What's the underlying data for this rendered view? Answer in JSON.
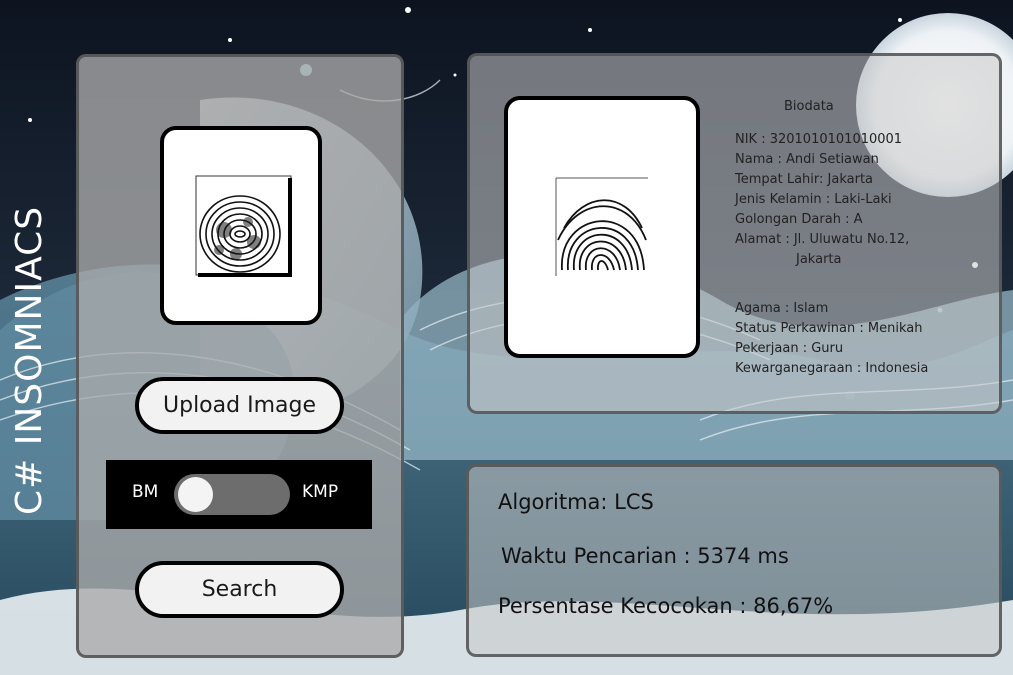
{
  "app": {
    "vertical_title": "C# INSOMNIACS"
  },
  "input": {
    "upload_label": "Upload Image",
    "search_label": "Search"
  },
  "algorithm_switch": {
    "left_label": "BM",
    "right_label": "KMP",
    "selected": "BM"
  },
  "biodata": {
    "title": "Biodata",
    "fields": [
      {
        "label": "NIK : 3201010101010001"
      },
      {
        "label": "Nama : Andi Setiawan"
      },
      {
        "label": "Tempat Lahir: Jakarta"
      },
      {
        "label": "Jenis Kelamin : Laki-Laki"
      },
      {
        "label": "Golongan Darah : A"
      },
      {
        "label": "Alamat : Jl. Uluwatu No.12,"
      },
      {
        "label": "Jakarta"
      }
    ],
    "fields2": [
      {
        "label": "Agama : Islam"
      },
      {
        "label": "Status Perkawinan : Menikah"
      },
      {
        "label": "Pekerjaan : Guru"
      },
      {
        "label": "Kewarganegaraan : Indonesia"
      }
    ]
  },
  "result": {
    "algorithm": "Algoritma: LCS",
    "time": "Waktu Pencarian : 5374 ms",
    "percentage": "Persentase Kecocokan : 86,67%"
  },
  "colors": {
    "panel_border": "#505050",
    "frame_border": "#000000",
    "switch_bg": "#000000",
    "toggle_track": "#6d6d6d"
  }
}
